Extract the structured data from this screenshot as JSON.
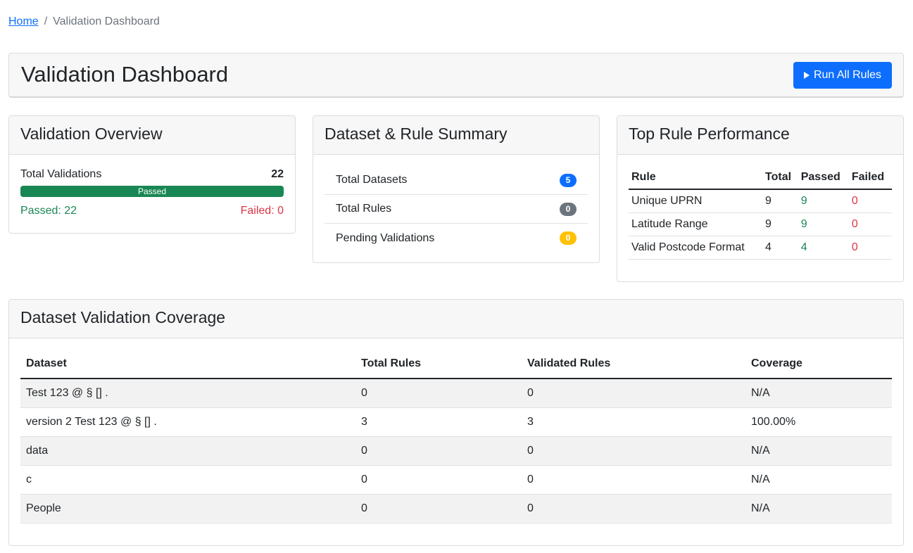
{
  "breadcrumb": {
    "home": "Home",
    "separator": "/",
    "current": "Validation Dashboard"
  },
  "header": {
    "title": "Validation Dashboard",
    "run_button": "Run All Rules"
  },
  "overview": {
    "title": "Validation Overview",
    "total_label": "Total Validations",
    "total_value": "22",
    "progress_label": "Passed",
    "progress_fraction": 1.0,
    "passed_text": "Passed: 22",
    "failed_text": "Failed: 0"
  },
  "summary": {
    "title": "Dataset & Rule Summary",
    "items": [
      {
        "label": "Total Datasets",
        "count": "5",
        "color": "#0d6efd"
      },
      {
        "label": "Total Rules",
        "count": "0",
        "color": "#6c757d"
      },
      {
        "label": "Pending Validations",
        "count": "0",
        "color": "#ffc107"
      }
    ]
  },
  "performance": {
    "title": "Top Rule Performance",
    "columns": [
      "Rule",
      "Total",
      "Passed",
      "Failed"
    ],
    "rows": [
      {
        "rule": "Unique UPRN",
        "total": "9",
        "passed": "9",
        "failed": "0"
      },
      {
        "rule": "Latitude Range",
        "total": "9",
        "passed": "9",
        "failed": "0"
      },
      {
        "rule": "Valid Postcode Format",
        "total": "4",
        "passed": "4",
        "failed": "0"
      }
    ]
  },
  "coverage": {
    "title": "Dataset Validation Coverage",
    "columns": [
      "Dataset",
      "Total Rules",
      "Validated Rules",
      "Coverage"
    ],
    "rows": [
      {
        "dataset": "Test 123 @ § [] .",
        "total_rules": "0",
        "validated_rules": "0",
        "coverage": "N/A"
      },
      {
        "dataset": "version 2 Test 123 @ § [] .",
        "total_rules": "3",
        "validated_rules": "3",
        "coverage": "100.00%"
      },
      {
        "dataset": "data",
        "total_rules": "0",
        "validated_rules": "0",
        "coverage": "N/A"
      },
      {
        "dataset": "c",
        "total_rules": "0",
        "validated_rules": "0",
        "coverage": "N/A"
      },
      {
        "dataset": "People",
        "total_rules": "0",
        "validated_rules": "0",
        "coverage": "N/A"
      }
    ]
  },
  "colors": {
    "primary": "#0d6efd",
    "success": "#198754",
    "danger": "#dc3545",
    "secondary": "#6c757d",
    "warning": "#ffc107"
  }
}
